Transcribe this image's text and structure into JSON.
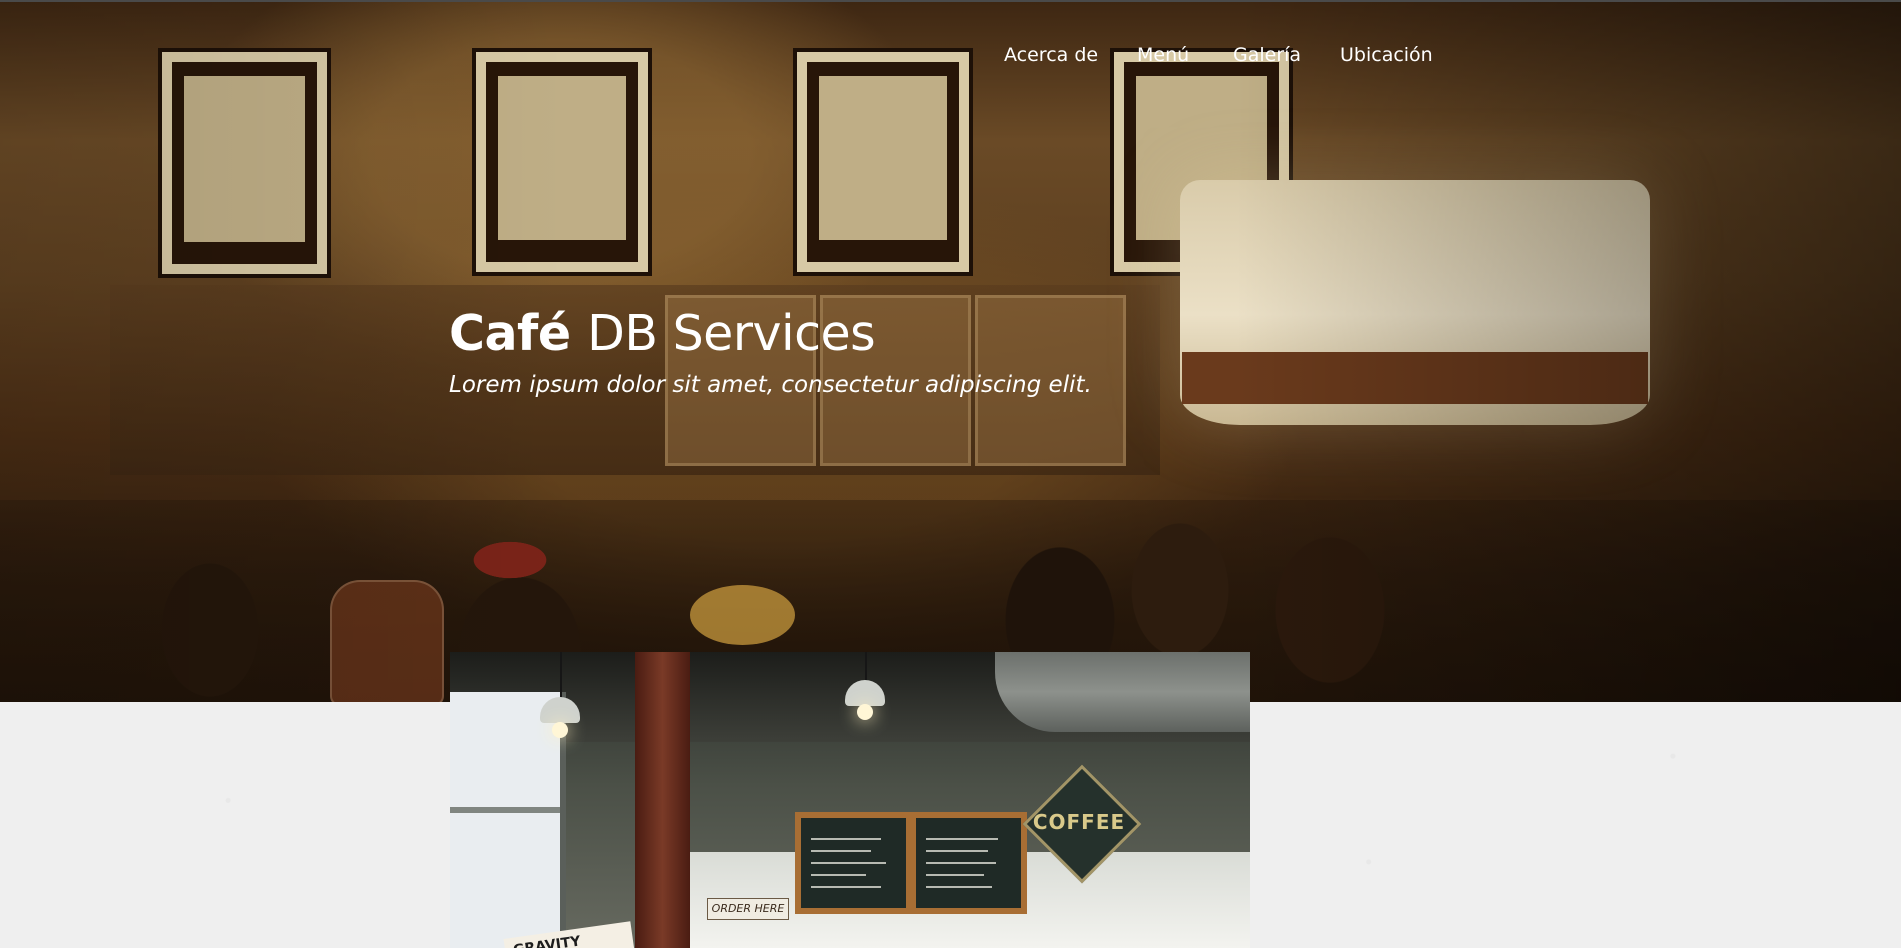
{
  "nav": {
    "items": [
      {
        "label": "Acerca de"
      },
      {
        "label": "Menú"
      },
      {
        "label": "Galería"
      },
      {
        "label": "Ubicación"
      }
    ]
  },
  "hero": {
    "title_bold": "Café",
    "title_rest": "DB Services",
    "subtitle": "Lorem ipsum dolor sit amet, consectetur adipiscing elit.",
    "background_image": "dim café interior with counter, framed posters and a drum pendant lamp"
  },
  "gallery": {
    "photo_description": "bright coffee shop interior with chalkboard menus and a diamond sign",
    "sign_text": "COFFEE",
    "counter_label": "ORDER HERE",
    "magazine_text": "GRAVITY"
  },
  "colors": {
    "hero_tint": "#2a1a0c",
    "page_background": "#efefef",
    "text": "#ffffff"
  }
}
